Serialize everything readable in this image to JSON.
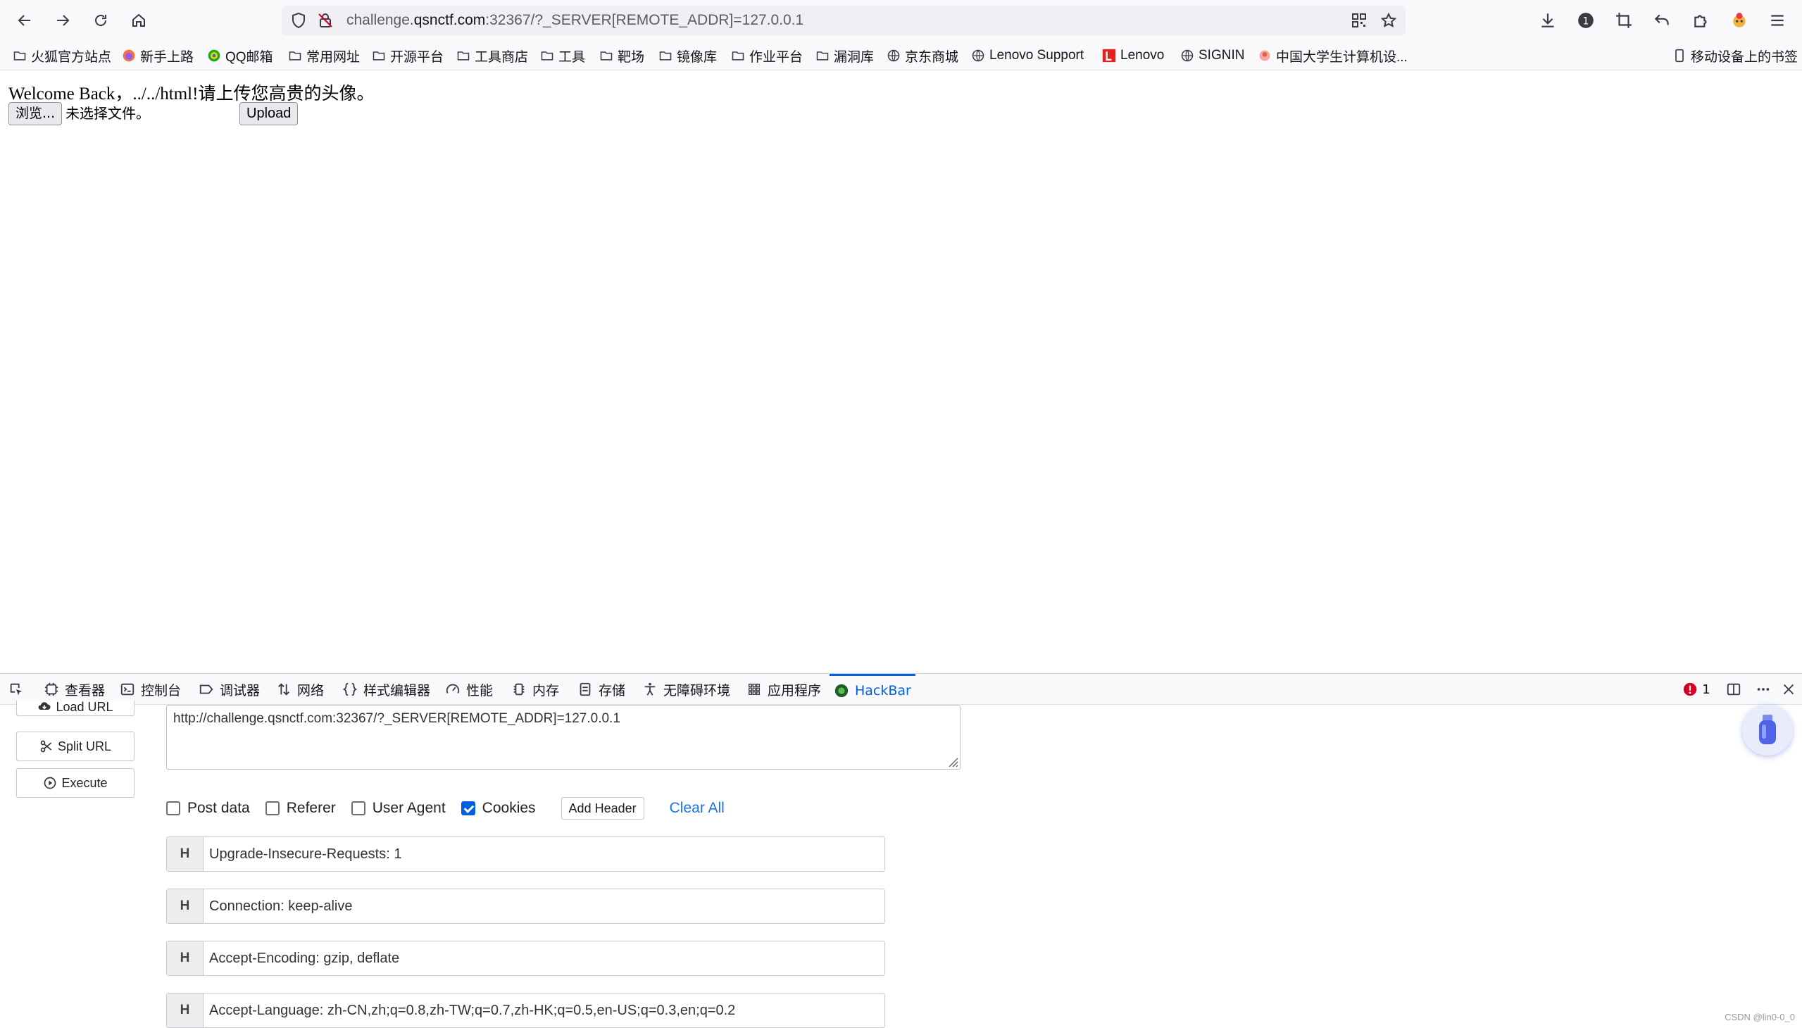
{
  "browser": {
    "url_prefix": "challenge.",
    "url_host": "qsnctf.com",
    "url_rest": ":32367/?_SERVER[REMOTE_ADDR]=127.0.0.1"
  },
  "bookmarks": [
    "火狐官方站点",
    "新手上路",
    "QQ邮箱",
    "常用网址",
    "开源平台",
    "工具商店",
    "工具",
    "靶场",
    "镜像库",
    "作业平台",
    "漏洞库",
    "京东商城",
    "Lenovo Support",
    "Lenovo",
    "SIGNIN",
    "中国大学生计算机设..."
  ],
  "mobile_bookmarks": "移动设备上的书签",
  "page": {
    "welcome": "Welcome Back，../../html!请上传您高贵的头像。",
    "browse_label": "浏览...",
    "file_status": "未选择文件。",
    "upload_label": "Upload"
  },
  "devtools": {
    "tabs": [
      "查看器",
      "控制台",
      "调试器",
      "网络",
      "样式编辑器",
      "性能",
      "内存",
      "存储",
      "无障碍环境",
      "应用程序",
      "HackBar"
    ],
    "error_count": "1"
  },
  "hackbar": {
    "load_url": "Load URL",
    "split_url": "Split URL",
    "execute": "Execute",
    "url_value": "http://challenge.qsnctf.com:32367/?_SERVER[REMOTE_ADDR]=127.0.0.1",
    "options": [
      {
        "label": "Post data",
        "checked": false
      },
      {
        "label": "Referer",
        "checked": false
      },
      {
        "label": "User Agent",
        "checked": false
      },
      {
        "label": "Cookies",
        "checked": true
      }
    ],
    "add_header": "Add Header",
    "clear_all": "Clear All",
    "header_prefix": "H",
    "headers": [
      "Upgrade-Insecure-Requests: 1",
      "Connection: keep-alive",
      "Accept-Encoding: gzip, deflate",
      "Accept-Language: zh-CN,zh;q=0.8,zh-TW;q=0.7,zh-HK;q=0.5,en-US;q=0.3,en;q=0.2"
    ]
  },
  "watermark": "CSDN @lin0-0_0",
  "colors": {
    "accent": "#0060df",
    "link": "#1a73e8",
    "error": "#d70022"
  }
}
